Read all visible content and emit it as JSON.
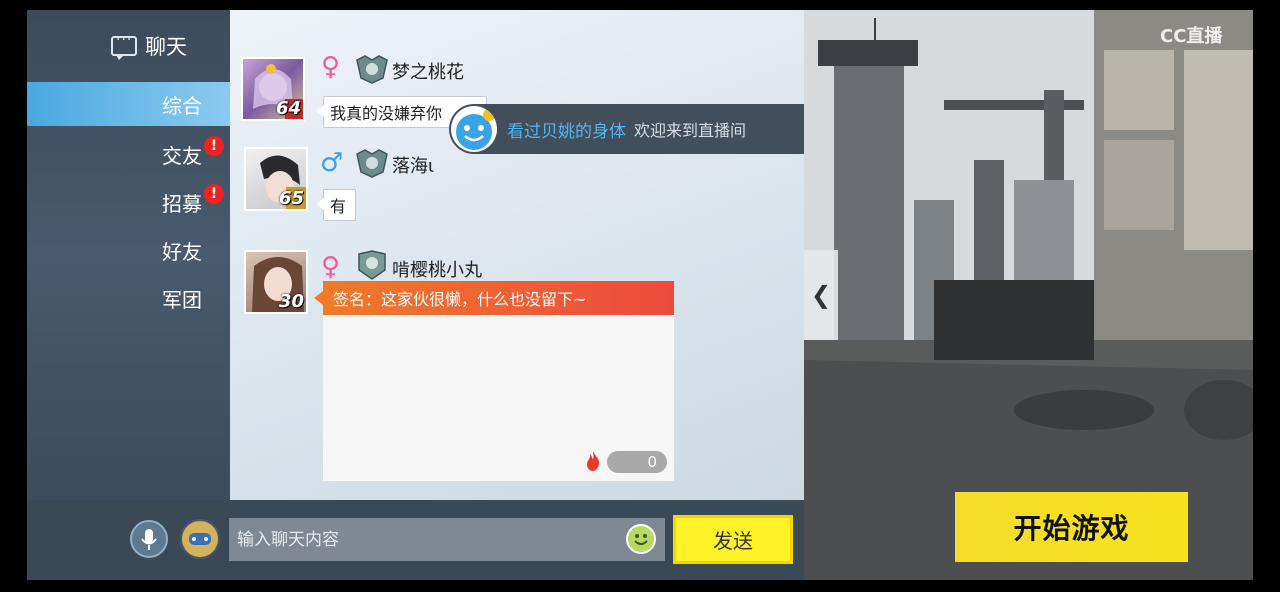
{
  "sidebar": {
    "title": "聊天",
    "items": [
      {
        "label": "综合",
        "active": true,
        "badge": ""
      },
      {
        "label": "交友",
        "active": false,
        "badge": "!"
      },
      {
        "label": "招募",
        "active": false,
        "badge": "!"
      },
      {
        "label": "好友",
        "active": false,
        "badge": ""
      },
      {
        "label": "军团",
        "active": false,
        "badge": ""
      }
    ]
  },
  "messages": [
    {
      "username": "梦之桃花",
      "gender": "female",
      "level": "64",
      "text": "我真的没嫌弃你"
    },
    {
      "username": "落海ι",
      "gender": "male",
      "level": "65",
      "text": "有"
    },
    {
      "username": "啃樱桃小丸",
      "gender": "female",
      "level": "30",
      "signature": "签名：这家伙很懒，什么也没留下~",
      "likes": "0"
    }
  ],
  "notification": {
    "name": "看过贝姚的身体",
    "text": "欢迎来到直播间"
  },
  "input": {
    "placeholder": "输入聊天内容",
    "send_label": "发送"
  },
  "scene": {
    "start_label": "开始游戏",
    "watermark": "CC直播"
  },
  "colors": {
    "active_tab": "#4aa8e0",
    "send_button": "#fff226",
    "signature_bar": "#ec4a3e",
    "notif_name": "#4fb6f4"
  }
}
